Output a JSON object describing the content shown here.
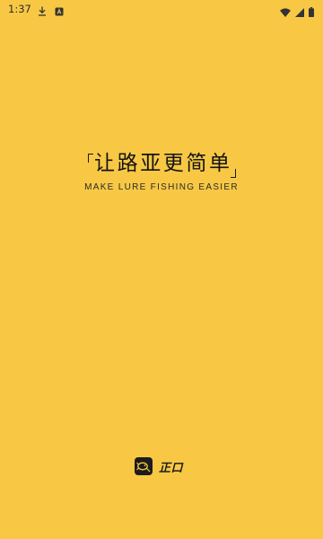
{
  "status_bar": {
    "time": "1:37",
    "left_icons": [
      "download-icon",
      "font-icon"
    ],
    "right_icons": [
      "wifi-icon",
      "signal-icon",
      "battery-icon"
    ]
  },
  "splash": {
    "slogan_zh": "让路亚更简单",
    "slogan_en": "MAKE LURE FISHING EASIER",
    "brand_name": "正口"
  },
  "colors": {
    "background": "#F8C845",
    "text": "#1a1a1a"
  }
}
